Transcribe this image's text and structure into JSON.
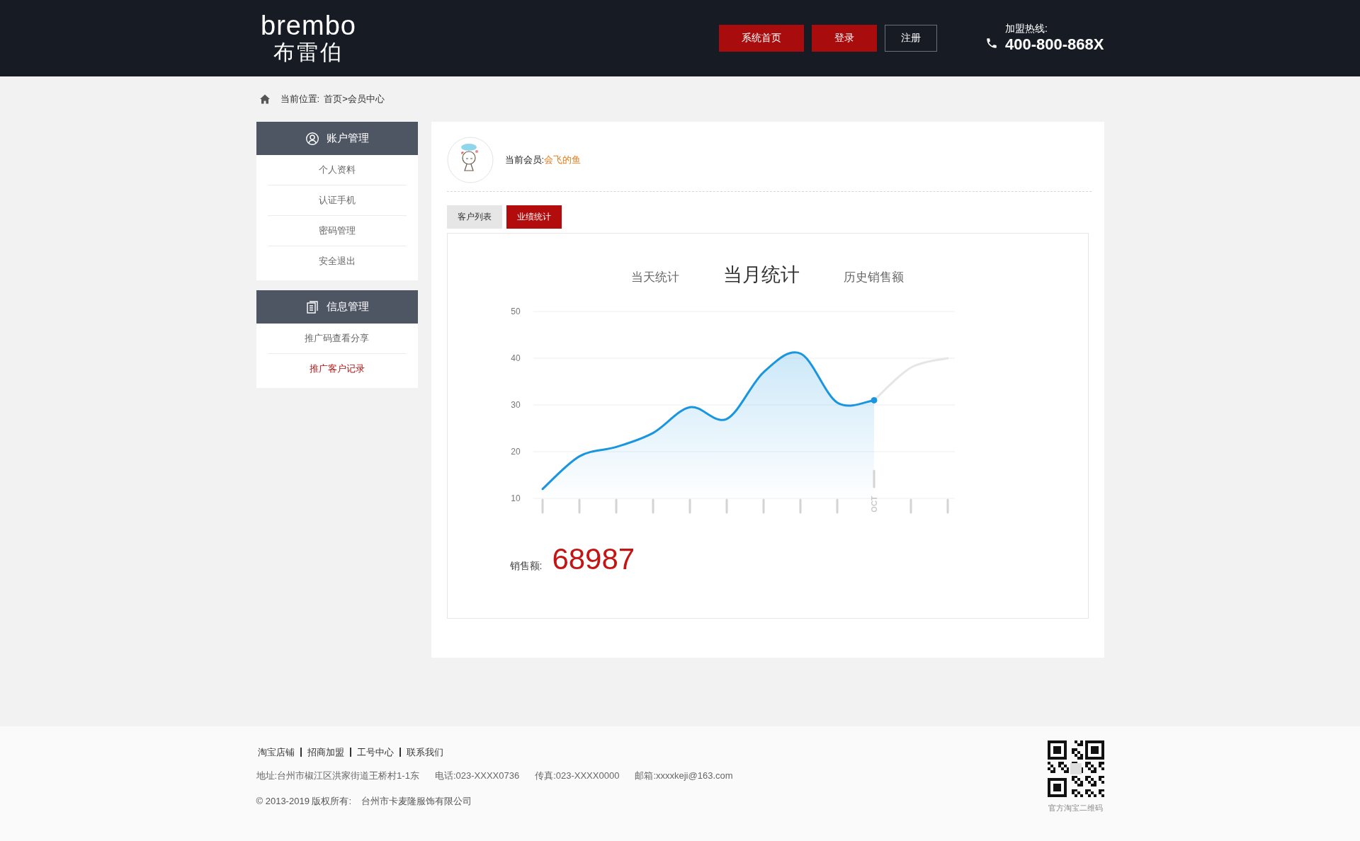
{
  "header": {
    "logo_text": "brembo",
    "logo_subtitle": "布雷伯",
    "nav_buttons": [
      {
        "label": "系统首页",
        "kind": "filled"
      },
      {
        "label": "登录",
        "kind": "filled"
      },
      {
        "label": "注册",
        "kind": "outline"
      }
    ],
    "hotline_label": "加盟热线:",
    "hotline_number": "400-800-868X"
  },
  "breadcrumb": {
    "label": "当前位置:",
    "path": "首页>会员中心"
  },
  "sidebar": {
    "sections": [
      {
        "title": "账户管理",
        "items": [
          {
            "label": "个人资料",
            "selected": false
          },
          {
            "label": "认证手机",
            "selected": false
          },
          {
            "label": "密码管理",
            "selected": false
          },
          {
            "label": "安全退出",
            "selected": false
          }
        ]
      },
      {
        "title": "信息管理",
        "items": [
          {
            "label": "推广码查看分享",
            "selected": false
          },
          {
            "label": "推广客户记录",
            "selected": true
          }
        ]
      }
    ]
  },
  "member": {
    "label": "当前会员:",
    "name": "会飞的鱼"
  },
  "tabs": [
    {
      "label": "客户列表",
      "selected": false
    },
    {
      "label": "业绩统计",
      "selected": true
    }
  ],
  "stats_tabs": [
    {
      "label": "当天统计",
      "selected": false
    },
    {
      "label": "当月统计",
      "selected": true
    },
    {
      "label": "历史销售额",
      "selected": false
    }
  ],
  "chart_data": {
    "type": "area",
    "grid": true,
    "annotations": [
      {
        "text": "OCT"
      }
    ],
    "ylim": [
      10,
      50
    ],
    "yticks": [
      10,
      20,
      30,
      40,
      50
    ],
    "series": [
      {
        "color": "#1a96e0",
        "values": [
          12,
          19,
          21,
          24,
          29.5,
          27,
          37,
          41,
          30.5,
          31,
          null,
          null
        ]
      },
      {
        "type": "line",
        "color": "#e6e6e6",
        "values": [
          null,
          null,
          null,
          null,
          null,
          null,
          null,
          null,
          null,
          31,
          38,
          40
        ]
      }
    ]
  },
  "sales": {
    "label": "销售额:",
    "value": "68987"
  },
  "footer": {
    "links": [
      "淘宝店铺",
      "招商加盟",
      "工号中心",
      "联系我们"
    ],
    "contacts": [
      "地址:台州市椒江区洪家街道王桥村1-1东",
      "电话:023-XXXX0736",
      "传真:023-XXXX0000",
      "邮箱:xxxxkeji@163.com"
    ],
    "copyright": "© 2013-2019 版权所有:",
    "company": "台州市卡麦隆服饰有限公司",
    "qr_caption": "官方淘宝二维码"
  }
}
